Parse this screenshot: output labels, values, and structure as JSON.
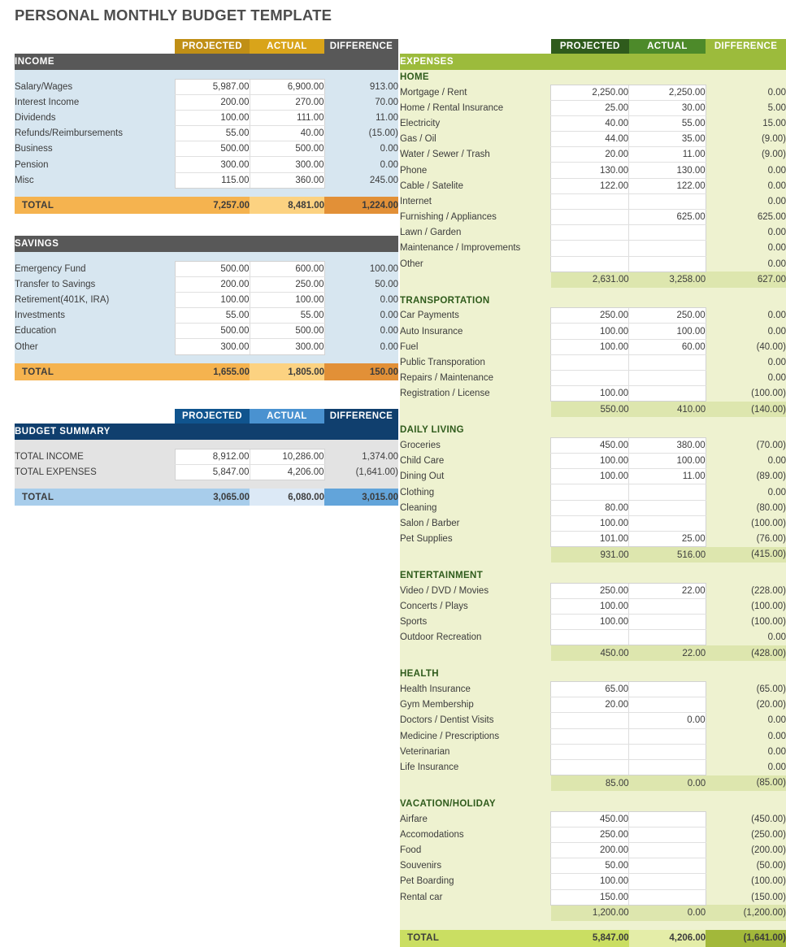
{
  "title": "PERSONAL MONTHLY BUDGET TEMPLATE",
  "columns": {
    "projected": "PROJECTED",
    "actual": "ACTUAL",
    "difference": "DIFFERENCE"
  },
  "labels": {
    "total": "TOTAL"
  },
  "income": {
    "section": "INCOME",
    "rows": [
      {
        "label": "Salary/Wages",
        "projected": "5,987.00",
        "actual": "6,900.00",
        "difference": "913.00"
      },
      {
        "label": "Interest Income",
        "projected": "200.00",
        "actual": "270.00",
        "difference": "70.00"
      },
      {
        "label": "Dividends",
        "projected": "100.00",
        "actual": "111.00",
        "difference": "11.00"
      },
      {
        "label": "Refunds/Reimbursements",
        "projected": "55.00",
        "actual": "40.00",
        "difference": "(15.00)"
      },
      {
        "label": "Business",
        "projected": "500.00",
        "actual": "500.00",
        "difference": "0.00"
      },
      {
        "label": "Pension",
        "projected": "300.00",
        "actual": "300.00",
        "difference": "0.00"
      },
      {
        "label": "Misc",
        "projected": "115.00",
        "actual": "360.00",
        "difference": "245.00"
      }
    ],
    "total": {
      "label": "TOTAL",
      "projected": "7,257.00",
      "actual": "8,481.00",
      "difference": "1,224.00"
    }
  },
  "savings": {
    "section": "SAVINGS",
    "rows": [
      {
        "label": "Emergency Fund",
        "projected": "500.00",
        "actual": "600.00",
        "difference": "100.00"
      },
      {
        "label": "Transfer to Savings",
        "projected": "200.00",
        "actual": "250.00",
        "difference": "50.00"
      },
      {
        "label": "Retirement(401K, IRA)",
        "projected": "100.00",
        "actual": "100.00",
        "difference": "0.00"
      },
      {
        "label": "Investments",
        "projected": "55.00",
        "actual": "55.00",
        "difference": "0.00"
      },
      {
        "label": "Education",
        "projected": "500.00",
        "actual": "500.00",
        "difference": "0.00"
      },
      {
        "label": "Other",
        "projected": "300.00",
        "actual": "300.00",
        "difference": "0.00"
      }
    ],
    "total": {
      "label": "TOTAL",
      "projected": "1,655.00",
      "actual": "1,805.00",
      "difference": "150.00"
    }
  },
  "budget_summary": {
    "section": "BUDGET SUMMARY",
    "rows": [
      {
        "label": "TOTAL INCOME",
        "projected": "8,912.00",
        "actual": "10,286.00",
        "difference": "1,374.00"
      },
      {
        "label": "TOTAL EXPENSES",
        "projected": "5,847.00",
        "actual": "4,206.00",
        "difference": "(1,641.00)"
      }
    ],
    "total": {
      "label": "TOTAL",
      "projected": "3,065.00",
      "actual": "6,080.00",
      "difference": "3,015.00"
    }
  },
  "expenses": {
    "section": "EXPENSES",
    "groups": [
      {
        "name": "HOME",
        "rows": [
          {
            "label": "Mortgage / Rent",
            "projected": "2,250.00",
            "actual": "2,250.00",
            "difference": "0.00"
          },
          {
            "label": "Home / Rental Insurance",
            "projected": "25.00",
            "actual": "30.00",
            "difference": "5.00"
          },
          {
            "label": "Electricity",
            "projected": "40.00",
            "actual": "55.00",
            "difference": "15.00"
          },
          {
            "label": "Gas / Oil",
            "projected": "44.00",
            "actual": "35.00",
            "difference": "(9.00)"
          },
          {
            "label": "Water / Sewer / Trash",
            "projected": "20.00",
            "actual": "11.00",
            "difference": "(9.00)"
          },
          {
            "label": "Phone",
            "projected": "130.00",
            "actual": "130.00",
            "difference": "0.00"
          },
          {
            "label": "Cable / Satelite",
            "projected": "122.00",
            "actual": "122.00",
            "difference": "0.00"
          },
          {
            "label": "Internet",
            "projected": "",
            "actual": "",
            "difference": "0.00"
          },
          {
            "label": "Furnishing / Appliances",
            "projected": "",
            "actual": "625.00",
            "difference": "625.00"
          },
          {
            "label": "Lawn / Garden",
            "projected": "",
            "actual": "",
            "difference": "0.00"
          },
          {
            "label": "Maintenance / Improvements",
            "projected": "",
            "actual": "",
            "difference": "0.00"
          },
          {
            "label": "Other",
            "projected": "",
            "actual": "",
            "difference": "0.00"
          }
        ],
        "subtotal": {
          "projected": "2,631.00",
          "actual": "3,258.00",
          "difference": "627.00"
        }
      },
      {
        "name": "TRANSPORTATION",
        "rows": [
          {
            "label": "Car Payments",
            "projected": "250.00",
            "actual": "250.00",
            "difference": "0.00"
          },
          {
            "label": "Auto Insurance",
            "projected": "100.00",
            "actual": "100.00",
            "difference": "0.00"
          },
          {
            "label": "Fuel",
            "projected": "100.00",
            "actual": "60.00",
            "difference": "(40.00)"
          },
          {
            "label": "Public Transporation",
            "projected": "",
            "actual": "",
            "difference": "0.00"
          },
          {
            "label": "Repairs / Maintenance",
            "projected": "",
            "actual": "",
            "difference": "0.00"
          },
          {
            "label": "Registration / License",
            "projected": "100.00",
            "actual": "",
            "difference": "(100.00)"
          }
        ],
        "subtotal": {
          "projected": "550.00",
          "actual": "410.00",
          "difference": "(140.00)"
        }
      },
      {
        "name": "DAILY LIVING",
        "rows": [
          {
            "label": "Groceries",
            "projected": "450.00",
            "actual": "380.00",
            "difference": "(70.00)"
          },
          {
            "label": "Child Care",
            "projected": "100.00",
            "actual": "100.00",
            "difference": "0.00"
          },
          {
            "label": "Dining Out",
            "projected": "100.00",
            "actual": "11.00",
            "difference": "(89.00)"
          },
          {
            "label": "Clothing",
            "projected": "",
            "actual": "",
            "difference": "0.00"
          },
          {
            "label": "Cleaning",
            "projected": "80.00",
            "actual": "",
            "difference": "(80.00)"
          },
          {
            "label": "Salon / Barber",
            "projected": "100.00",
            "actual": "",
            "difference": "(100.00)"
          },
          {
            "label": "Pet Supplies",
            "projected": "101.00",
            "actual": "25.00",
            "difference": "(76.00)"
          }
        ],
        "subtotal": {
          "projected": "931.00",
          "actual": "516.00",
          "difference": "(415.00)"
        }
      },
      {
        "name": "ENTERTAINMENT",
        "rows": [
          {
            "label": "Video / DVD / Movies",
            "projected": "250.00",
            "actual": "22.00",
            "difference": "(228.00)"
          },
          {
            "label": "Concerts / Plays",
            "projected": "100.00",
            "actual": "",
            "difference": "(100.00)"
          },
          {
            "label": "Sports",
            "projected": "100.00",
            "actual": "",
            "difference": "(100.00)"
          },
          {
            "label": "Outdoor Recreation",
            "projected": "",
            "actual": "",
            "difference": "0.00"
          }
        ],
        "subtotal": {
          "projected": "450.00",
          "actual": "22.00",
          "difference": "(428.00)"
        }
      },
      {
        "name": "HEALTH",
        "rows": [
          {
            "label": "Health Insurance",
            "projected": "65.00",
            "actual": "",
            "difference": "(65.00)"
          },
          {
            "label": "Gym Membership",
            "projected": "20.00",
            "actual": "",
            "difference": "(20.00)"
          },
          {
            "label": "Doctors / Dentist Visits",
            "projected": "",
            "actual": "0.00",
            "difference": "0.00"
          },
          {
            "label": "Medicine / Prescriptions",
            "projected": "",
            "actual": "",
            "difference": "0.00"
          },
          {
            "label": "Veterinarian",
            "projected": "",
            "actual": "",
            "difference": "0.00"
          },
          {
            "label": "Life Insurance",
            "projected": "",
            "actual": "",
            "difference": "0.00"
          }
        ],
        "subtotal": {
          "projected": "85.00",
          "actual": "0.00",
          "difference": "(85.00)"
        }
      },
      {
        "name": "VACATION/HOLIDAY",
        "rows": [
          {
            "label": "Airfare",
            "projected": "450.00",
            "actual": "",
            "difference": "(450.00)"
          },
          {
            "label": "Accomodations",
            "projected": "250.00",
            "actual": "",
            "difference": "(250.00)"
          },
          {
            "label": "Food",
            "projected": "200.00",
            "actual": "",
            "difference": "(200.00)"
          },
          {
            "label": "Souvenirs",
            "projected": "50.00",
            "actual": "",
            "difference": "(50.00)"
          },
          {
            "label": "Pet Boarding",
            "projected": "100.00",
            "actual": "",
            "difference": "(100.00)"
          },
          {
            "label": "Rental car",
            "projected": "150.00",
            "actual": "",
            "difference": "(150.00)"
          }
        ],
        "subtotal": {
          "projected": "1,200.00",
          "actual": "0.00",
          "difference": "(1,200.00)"
        }
      }
    ],
    "total": {
      "label": "TOTAL",
      "projected": "5,847.00",
      "actual": "4,206.00",
      "difference": "(1,641.00)"
    }
  },
  "colors": {
    "gold_projected": "#c08f16",
    "gold_actual": "#d9a41a",
    "gray_section": "#585858",
    "income_body": "#d7e6f0",
    "total_orange": "#f5b34f",
    "blue_projected": "#10548e",
    "blue_actual": "#4a92d0",
    "navy_section": "#103f6e",
    "summary_body": "#e3e3e3",
    "green_projected": "#2f5b1c",
    "green_actual": "#4d8a2a",
    "green_section": "#9cbb3c",
    "expenses_body": "#eef2d0",
    "subtotal_green": "#dde6ae",
    "total_green": "#cade62"
  }
}
